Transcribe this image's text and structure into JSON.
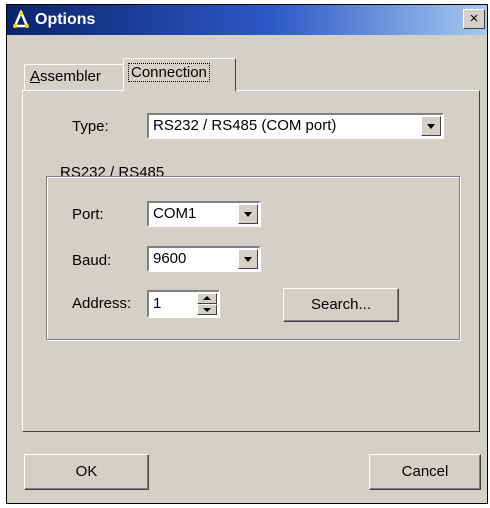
{
  "window": {
    "title": "Options",
    "close_label": "×"
  },
  "tabs": [
    {
      "label": "Assembler",
      "mnemonic": "A",
      "selected": false
    },
    {
      "label": "Connection",
      "selected": true
    }
  ],
  "connection": {
    "type_label": "Type:",
    "type_value": "RS232 / RS485 (COM port)",
    "group_title": "RS232 / RS485",
    "port_label": "Port:",
    "port_value": "COM1",
    "baud_label": "Baud:",
    "baud_value": "9600",
    "address_label": "Address:",
    "address_value": "1",
    "search_label": "Search..."
  },
  "buttons": {
    "ok": "OK",
    "cancel": "Cancel"
  },
  "colors": {
    "dialog_bg": "#d4d0c8",
    "title_start": "#0a246a",
    "title_end": "#a6caf0"
  }
}
